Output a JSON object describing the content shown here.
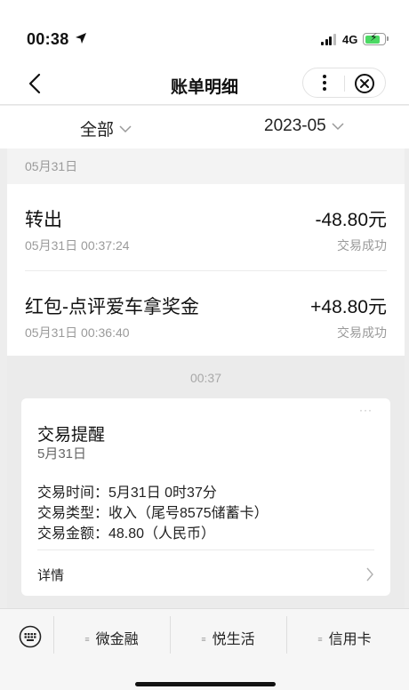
{
  "status_bar": {
    "time": "00:38",
    "network": "4G"
  },
  "nav": {
    "title": "账单明细"
  },
  "filter": {
    "category": "全部",
    "month": "2023-05"
  },
  "bills": {
    "date_header": "05月31日",
    "items": [
      {
        "name": "转出",
        "datetime": "05月31日 00:37:24",
        "amount": "-48.80元",
        "status": "交易成功"
      },
      {
        "name": "红包-点评爱车拿奖金",
        "datetime": "05月31日 00:36:40",
        "amount": "+48.80元",
        "status": "交易成功"
      }
    ]
  },
  "chat": {
    "time": "00:37",
    "card": {
      "more": "···",
      "title": "交易提醒",
      "date": "5月31日",
      "lines": [
        "交易时间：5月31日 0时37分",
        "交易类型：收入（尾号8575储蓄卡）",
        "交易金额：48.80（人民币）"
      ],
      "detail_label": "详情"
    }
  },
  "menu": {
    "items": [
      "微金融",
      "悦生活",
      "信用卡"
    ],
    "item_icon": "≡"
  },
  "colors": {
    "battery": "#4cd964",
    "page_background": "#ededed",
    "secondary_text": "#9a9a9a"
  },
  "icons": [
    "location-arrow-icon",
    "signal-icon",
    "battery-icon",
    "back-chevron-icon",
    "more-vertical-icon",
    "close-circle-icon",
    "chevron-down-icon",
    "chevron-right-icon",
    "keyboard-icon"
  ]
}
